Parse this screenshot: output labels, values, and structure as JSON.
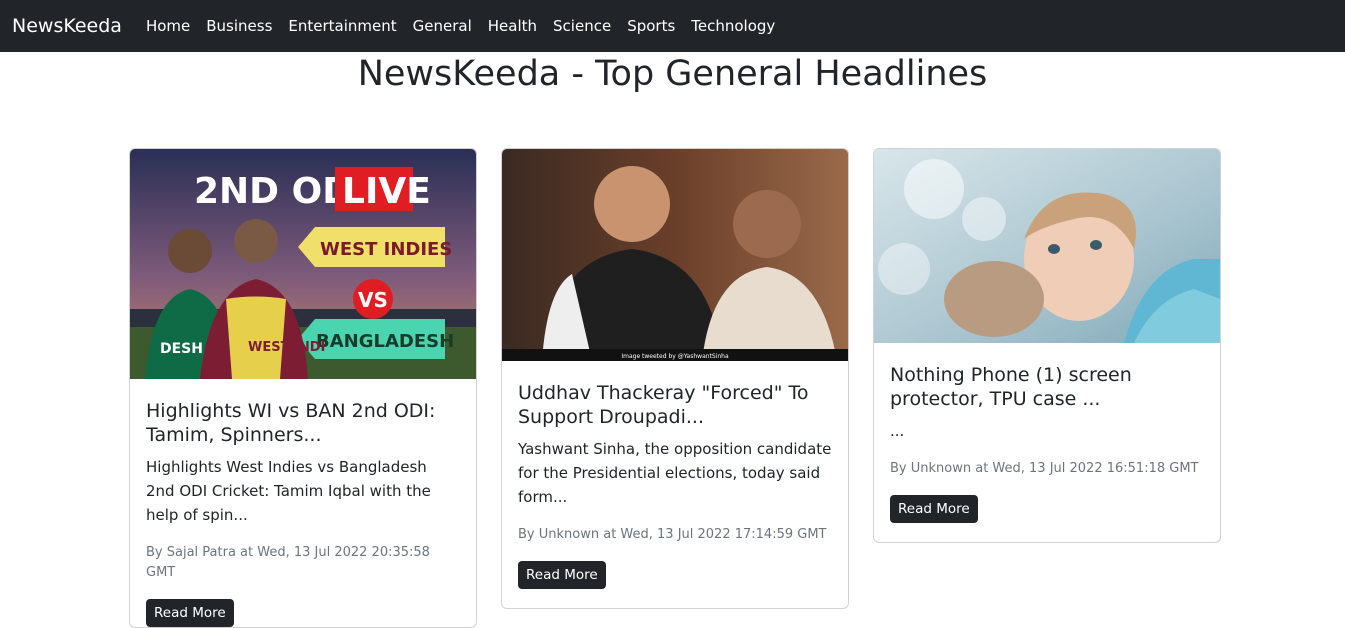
{
  "navbar": {
    "brand": "NewsKeeda",
    "links": [
      "Home",
      "Business",
      "Entertainment",
      "General",
      "Health",
      "Science",
      "Sports",
      "Technology"
    ]
  },
  "page": {
    "title": "NewsKeeda - Top General Headlines"
  },
  "cards": [
    {
      "image_text": {
        "line1": "2ND ODI",
        "live": "LIVE",
        "team1": "WEST INDIES",
        "vs": "VS",
        "team2": "BANGLADESH",
        "jersey1": "DESH",
        "jersey2": "WEST INDI"
      },
      "title": "Highlights WI vs BAN 2nd ODI: Tamim, Spinners...",
      "description": "Highlights West Indies vs Bangladesh 2nd ODI Cricket: Tamim Iqbal with the help of spin...",
      "meta": "By Sajal Patra at Wed, 13 Jul 2022 20:35:58 GMT",
      "button": "Read More"
    },
    {
      "image_text": {
        "caption": "Image tweeted by @YashwantSinha"
      },
      "title": "Uddhav Thackeray \"Forced\" To Support Droupadi...",
      "description": "Yashwant Sinha, the opposition candidate for the Presidential elections, today said form...",
      "meta": "By Unknown at Wed, 13 Jul 2022 17:14:59 GMT",
      "button": "Read More"
    },
    {
      "title": "Nothing Phone (1) screen protector, TPU case ...",
      "description": "...",
      "meta": "By Unknown at Wed, 13 Jul 2022 16:51:18 GMT",
      "button": "Read More"
    }
  ]
}
